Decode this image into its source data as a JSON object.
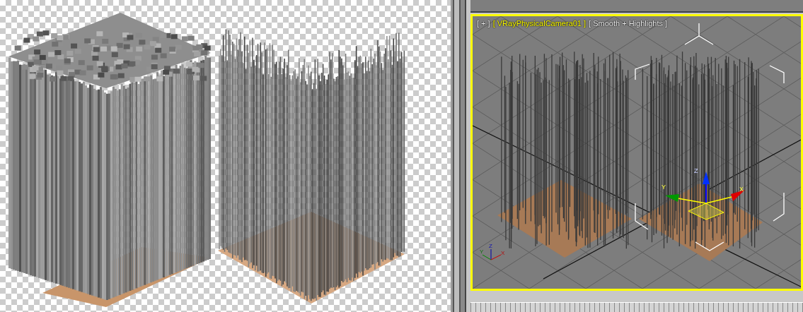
{
  "viewport": {
    "active": true,
    "labels": [
      "[ + ]",
      "[ VRayPhysicalCamera01 ]",
      "[ Smooth + Highlights ]"
    ],
    "gizmo_axes": [
      "Z",
      "Y",
      "X"
    ],
    "axis_tripod": [
      "Z",
      "Y",
      "X"
    ]
  }
}
